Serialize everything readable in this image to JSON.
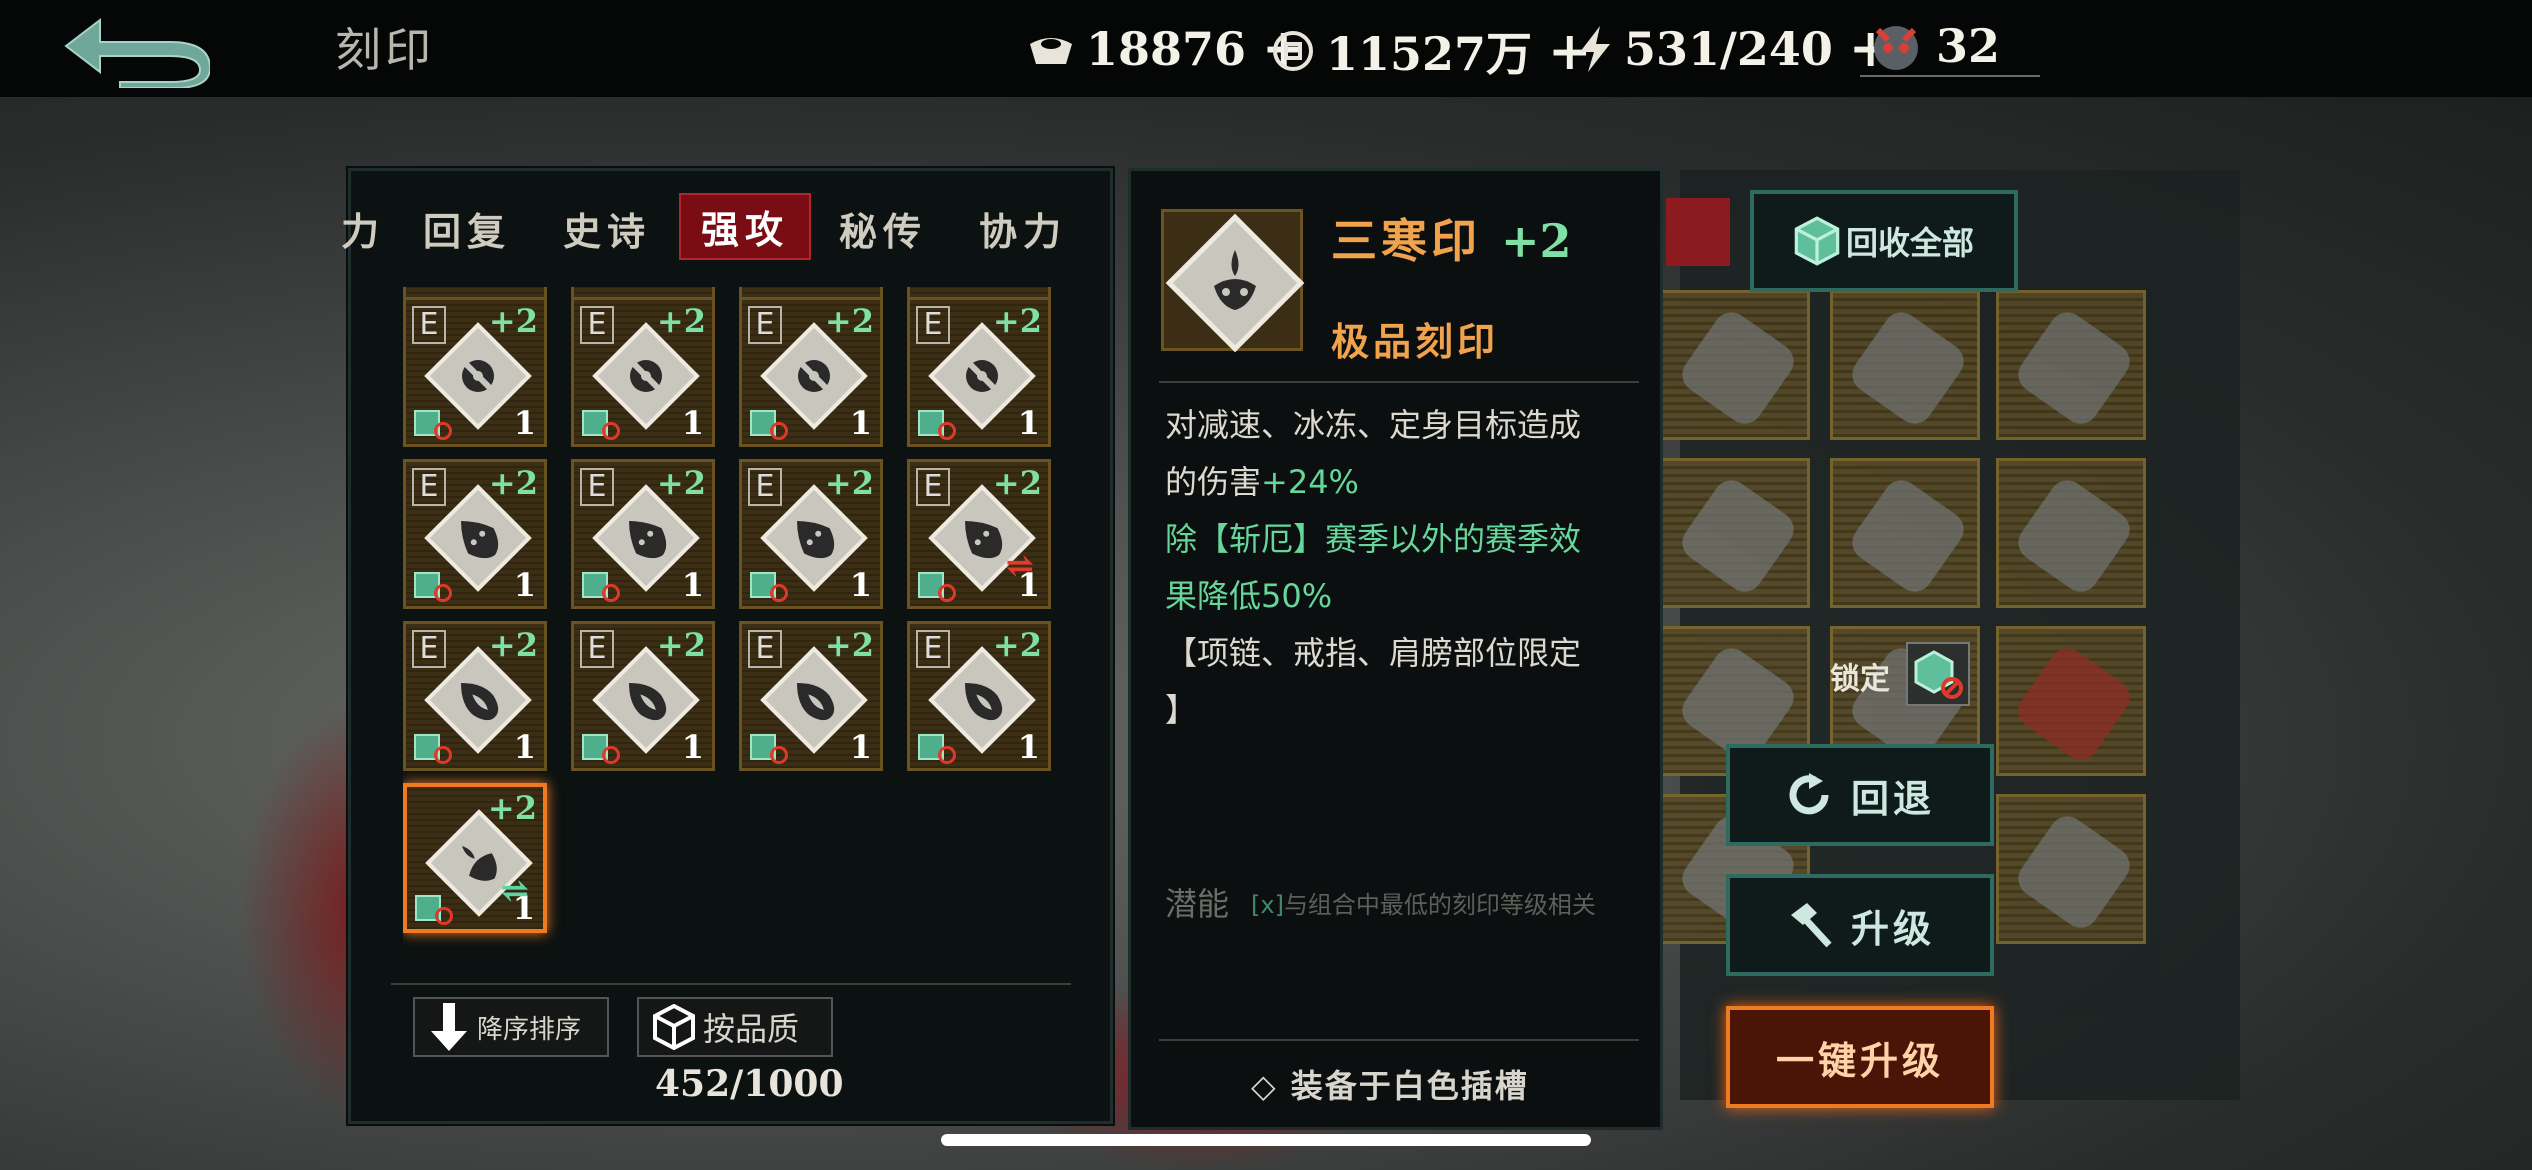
{
  "header": {
    "title": "刻印",
    "resources": [
      {
        "icon": "silver-ingot-icon",
        "value": "18876",
        "plus": "+"
      },
      {
        "icon": "coin-icon",
        "value": "11527万",
        "plus": "+"
      },
      {
        "icon": "energy-icon",
        "value": "531/240",
        "plus": "+"
      },
      {
        "icon": "demon-mask-icon",
        "value": "32",
        "plus": ""
      }
    ]
  },
  "tabs": [
    {
      "label": "力"
    },
    {
      "label": "回复"
    },
    {
      "label": "史诗"
    },
    {
      "label": "强攻",
      "active": true
    },
    {
      "label": "秘传"
    },
    {
      "label": "协力"
    }
  ],
  "grid": {
    "rows": [
      {
        "glyph": "disc",
        "items": [
          {
            "grade": "E",
            "level": "+2",
            "count": "1"
          },
          {
            "grade": "E",
            "level": "+2",
            "count": "1"
          },
          {
            "grade": "E",
            "level": "+2",
            "count": "1"
          },
          {
            "grade": "E",
            "level": "+2",
            "count": "1"
          }
        ]
      },
      {
        "glyph": "flame-figure",
        "items": [
          {
            "grade": "E",
            "level": "+2",
            "count": "1"
          },
          {
            "grade": "E",
            "level": "+2",
            "count": "1"
          },
          {
            "grade": "E",
            "level": "+2",
            "count": "1"
          },
          {
            "grade": "E",
            "level": "+2",
            "count": "1",
            "swap": "red"
          }
        ]
      },
      {
        "glyph": "flame",
        "items": [
          {
            "grade": "E",
            "level": "+2",
            "count": "1"
          },
          {
            "grade": "E",
            "level": "+2",
            "count": "1"
          },
          {
            "grade": "E",
            "level": "+2",
            "count": "1"
          },
          {
            "grade": "E",
            "level": "+2",
            "count": "1"
          }
        ]
      },
      {
        "glyph": "three-cold",
        "items": [
          {
            "grade": "",
            "level": "+2",
            "count": "1",
            "selected": true,
            "swap": "green"
          }
        ]
      }
    ]
  },
  "sort": {
    "descending_label": "降序排序",
    "quality_label": "按品质",
    "count": "452/1000"
  },
  "detail": {
    "name": "三寒印",
    "level": "+2",
    "quality": "极品刻印",
    "desc_line1": "对减速、冰冻、定身目标造成",
    "desc_line2_a": "的伤害",
    "desc_line2_b": "+24%",
    "desc_line3": "除【斩厄】赛季以外的赛季效",
    "desc_line4": "果降低50%",
    "desc_line5": "【项链、戒指、肩膀部位限定",
    "desc_line6": "】",
    "potential_label": "潜能",
    "potential_x": "[x]",
    "potential_desc": "与组合中最低的刻印等级相关",
    "equip_label": "◇ 装备于白色插槽"
  },
  "actions": {
    "recycle_all": "回收全部",
    "lock": "锁定",
    "revert": "回退",
    "upgrade": "升级",
    "one_click_upgrade": "一键升级"
  },
  "colors": {
    "accent_orange": "#f0a24c",
    "level_green": "#7fe0a6",
    "active_tab": "#7a0d14",
    "teal_border": "#2e6a60"
  }
}
